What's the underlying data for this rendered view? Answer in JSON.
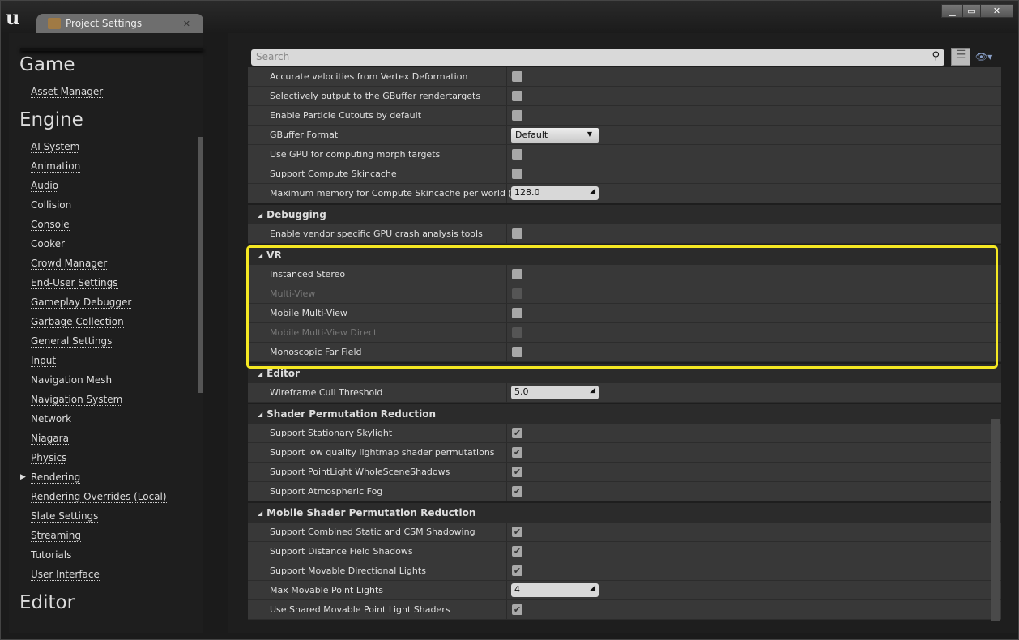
{
  "window": {
    "tab_title": "Project Settings",
    "controls": [
      "minimize",
      "maximize",
      "close"
    ],
    "highlight_color": "#f5e823"
  },
  "sidebar": {
    "sections": [
      {
        "title": "Game",
        "items": [
          "Asset Manager"
        ]
      },
      {
        "title": "Engine",
        "items": [
          "AI System",
          "Animation",
          "Audio",
          "Collision",
          "Console",
          "Cooker",
          "Crowd Manager",
          "End-User Settings",
          "Gameplay Debugger",
          "Garbage Collection",
          "General Settings",
          "Input",
          "Navigation Mesh",
          "Navigation System",
          "Network",
          "Niagara",
          "Physics",
          "Rendering",
          "Rendering Overrides (Local)",
          "Slate Settings",
          "Streaming",
          "Tutorials",
          "User Interface"
        ]
      },
      {
        "title": "Editor",
        "items": []
      }
    ],
    "current": "Rendering"
  },
  "search": {
    "placeholder": "Search"
  },
  "groups": [
    {
      "header": null,
      "rows": [
        {
          "label": "Accurate velocities from Vertex Deformation",
          "type": "check",
          "checked": false
        },
        {
          "label": "Selectively output to the GBuffer rendertargets",
          "type": "check",
          "checked": false
        },
        {
          "label": "Enable Particle Cutouts by default",
          "type": "check",
          "checked": false
        },
        {
          "label": "GBuffer Format",
          "type": "dropdown",
          "value": "Default"
        },
        {
          "label": "Use GPU for computing morph targets",
          "type": "check",
          "checked": false
        },
        {
          "label": "Support Compute Skincache",
          "type": "check",
          "checked": false
        },
        {
          "label": "Maximum memory for Compute Skincache per world (MB)",
          "type": "number",
          "value": "128.0"
        }
      ]
    },
    {
      "header": "Debugging",
      "rows": [
        {
          "label": "Enable vendor specific GPU crash analysis tools",
          "type": "check",
          "checked": false
        }
      ]
    },
    {
      "header": "VR",
      "rows": [
        {
          "label": "Instanced Stereo",
          "type": "check",
          "checked": false
        },
        {
          "label": "Multi-View",
          "type": "check",
          "checked": false,
          "disabled": true
        },
        {
          "label": "Mobile Multi-View",
          "type": "check",
          "checked": false
        },
        {
          "label": "Mobile Multi-View Direct",
          "type": "check",
          "checked": false,
          "disabled": true
        },
        {
          "label": "Monoscopic Far Field",
          "type": "check",
          "checked": false
        }
      ]
    },
    {
      "header": "Editor",
      "rows": [
        {
          "label": "Wireframe Cull Threshold",
          "type": "number",
          "value": "5.0"
        }
      ]
    },
    {
      "header": "Shader Permutation Reduction",
      "rows": [
        {
          "label": "Support Stationary Skylight",
          "type": "check",
          "checked": true
        },
        {
          "label": "Support low quality lightmap shader permutations",
          "type": "check",
          "checked": true
        },
        {
          "label": "Support PointLight WholeSceneShadows",
          "type": "check",
          "checked": true
        },
        {
          "label": "Support Atmospheric Fog",
          "type": "check",
          "checked": true
        }
      ]
    },
    {
      "header": "Mobile Shader Permutation Reduction",
      "rows": [
        {
          "label": "Support Combined Static and CSM Shadowing",
          "type": "check",
          "checked": true
        },
        {
          "label": "Support Distance Field Shadows",
          "type": "check",
          "checked": true
        },
        {
          "label": "Support Movable Directional Lights",
          "type": "check",
          "checked": true
        },
        {
          "label": "Max Movable Point Lights",
          "type": "number",
          "value": "4"
        },
        {
          "label": "Use Shared Movable Point Light Shaders",
          "type": "check",
          "checked": true
        }
      ]
    }
  ]
}
